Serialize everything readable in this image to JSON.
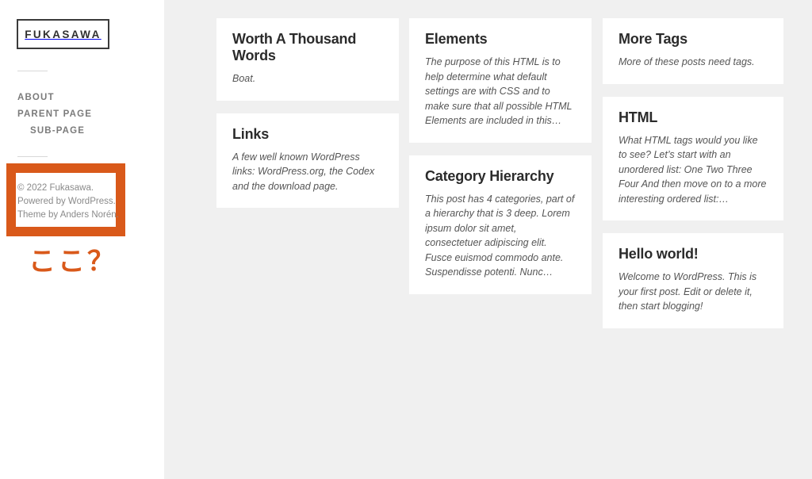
{
  "sidebar": {
    "logo": {
      "text": "FUKASAWA"
    },
    "nav": [
      {
        "label": "ABOUT",
        "level": 1
      },
      {
        "label": "PARENT PAGE",
        "level": 1
      },
      {
        "label": "SUB-PAGE",
        "level": 2
      }
    ],
    "footer": {
      "lines": [
        "© 2022 Fukasawa.",
        "Powered by WordPress.",
        "Theme by Anders Norén."
      ]
    },
    "annotation": {
      "label": "ここ？",
      "color": "#d9591a"
    }
  },
  "content": {
    "columns": [
      {
        "cards": [
          {
            "title": "Worth A Thousand Words",
            "excerpt": "Boat."
          },
          {
            "title": "Links",
            "excerpt": "A few well known WordPress links: WordPress.org, the Codex and the download page."
          }
        ]
      },
      {
        "cards": [
          {
            "title": "Elements",
            "excerpt": "The purpose of this HTML is to help determine what default settings are with CSS and to make sure that all possible HTML Elements are included in this…"
          },
          {
            "title": "Category Hierarchy",
            "excerpt": "This post has 4 categories, part of a hierarchy that is 3 deep. Lorem ipsum dolor sit amet, consectetuer adipiscing elit. Fusce euismod commodo ante. Suspendisse potenti. Nunc…"
          }
        ]
      },
      {
        "cards": [
          {
            "title": "More Tags",
            "excerpt": "More of these posts need tags."
          },
          {
            "title": "HTML",
            "excerpt": "What HTML tags would you like to see? Let’s start with an unordered list: One Two Three Four And then move on to a more interesting ordered list:…"
          },
          {
            "title": "Hello world!",
            "excerpt": "Welcome to WordPress. This is your first post. Edit or delete it, then start blogging!"
          }
        ]
      }
    ]
  },
  "theme": {
    "accent": "#d9591a",
    "page_background": "#f0f0f0",
    "sidebar_background": "#ffffff",
    "card_background": "#ffffff"
  }
}
